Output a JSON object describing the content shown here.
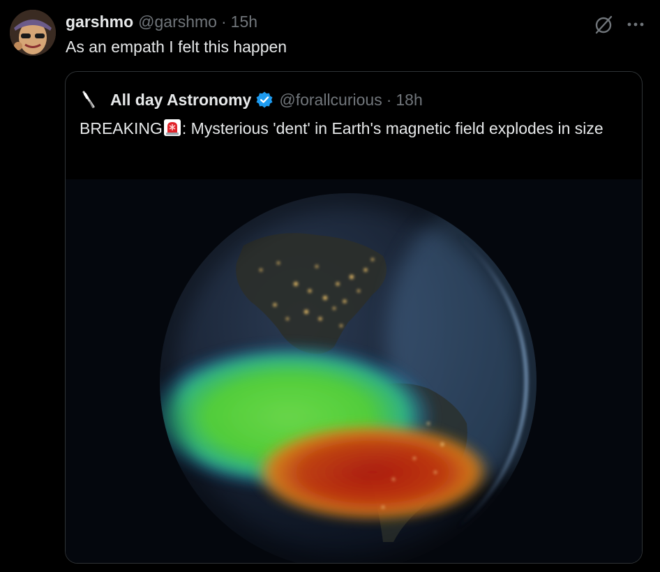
{
  "tweet": {
    "author_name": "garshmo",
    "author_handle": "@garshmo",
    "separator": "·",
    "time": "15h",
    "text": "As an empath I felt this happen",
    "icons": {
      "avatar": "avatar-image",
      "grok": "slash-circle-icon",
      "more": "more-icon"
    }
  },
  "quote": {
    "author_name": "All day Astronomy",
    "author_handle": "@forallcurious",
    "separator": "·",
    "time": "18h",
    "text_prefix": "BREAKING",
    "text_suffix": ": Mysterious 'dent' in Earth's magnetic field explodes in size",
    "icons": {
      "avatar": "telescope-icon",
      "verified": "verified-badge-icon",
      "siren": "siren-emoji-icon"
    },
    "media": {
      "alt": "Earth image"
    }
  },
  "colors": {
    "background": "#000000",
    "primary_text": "#e7e9ea",
    "secondary_text": "#71767b",
    "border": "#2f3336",
    "verified": "#1d9bf0",
    "siren": "#e0242b"
  }
}
